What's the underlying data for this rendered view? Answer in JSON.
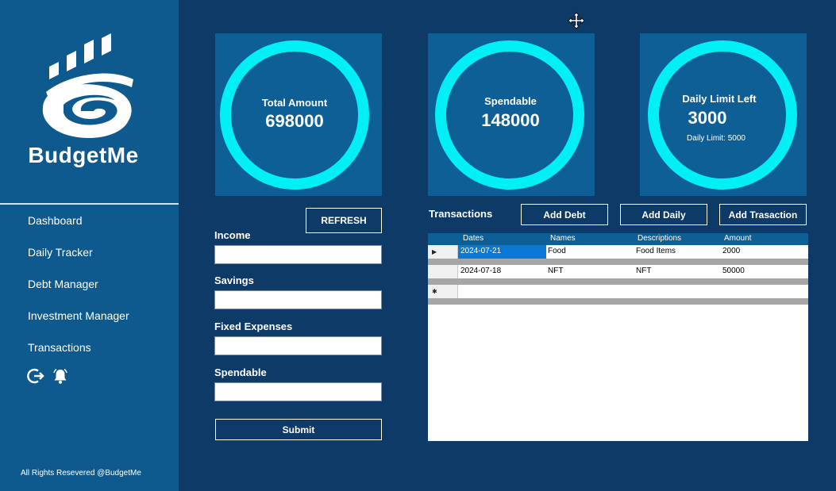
{
  "app": {
    "brand": "BudgetMe",
    "footer": "All Rights Resevered @BudgetMe"
  },
  "sidebar": {
    "items": [
      {
        "label": "Dashboard"
      },
      {
        "label": "Daily Tracker"
      },
      {
        "label": "Debt Manager"
      },
      {
        "label": "Investment Manager"
      },
      {
        "label": "Transactions"
      }
    ],
    "icons": [
      "logout-icon",
      "bell-icon"
    ]
  },
  "cards": [
    {
      "label": "Total Amount",
      "value": "698000"
    },
    {
      "label": "Spendable",
      "value": "148000"
    },
    {
      "label": "Daily Limit Left",
      "value": "3000",
      "sub": "Daily Limit: 5000"
    }
  ],
  "form": {
    "refresh_label": "REFRESH",
    "fields": [
      {
        "label": "Income",
        "value": ""
      },
      {
        "label": "Savings",
        "value": ""
      },
      {
        "label": "Fixed Expenses",
        "value": ""
      },
      {
        "label": "Spendable",
        "value": ""
      }
    ],
    "submit_label": "Submit"
  },
  "transactions": {
    "title": "Transactions",
    "buttons": {
      "add_debt": "Add Debt",
      "add_daily": "Add Daily",
      "add_transaction": "Add Trasaction"
    },
    "columns": [
      "Dates",
      "Names",
      "Descriptions",
      "Amount"
    ],
    "rows": [
      {
        "date": "2024-07-21",
        "name": "Food",
        "description": "Food Items",
        "amount": "2000"
      },
      {
        "date": "2024-07-18",
        "name": "NFT",
        "description": "NFT",
        "amount": "50000"
      }
    ]
  },
  "colors": {
    "background": "#0d3a66",
    "sidebar": "#0e5a8f",
    "card": "#0e5f95",
    "ring": "#00f0f5"
  }
}
